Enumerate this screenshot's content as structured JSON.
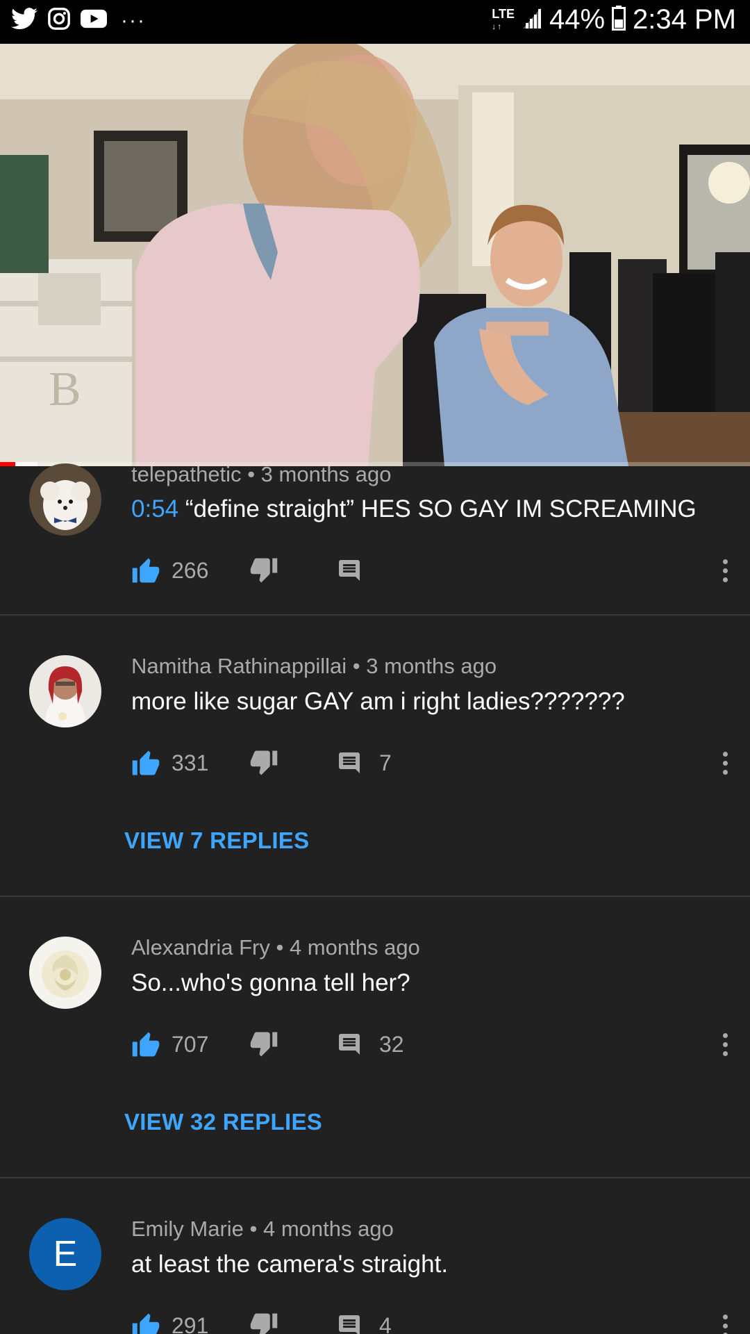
{
  "status_bar": {
    "network": "LTE",
    "battery": "44%",
    "time": "2:34 PM",
    "overflow": "···",
    "icons": [
      "twitter-icon",
      "instagram-icon",
      "youtube-icon"
    ]
  },
  "video": {
    "progress": 0.02,
    "buffered": 0.05,
    "accent": "#ff0000"
  },
  "comments": [
    {
      "author": "telepathetic",
      "time": "3 months ago",
      "timestamp_link": "0:54",
      "text": "“define straight” HES SO GAY IM SCREAMING",
      "likes": "266",
      "replies": "",
      "view_replies": ""
    },
    {
      "author": "Namitha Rathinappillai",
      "time": "3 months ago",
      "timestamp_link": "",
      "text": "more like sugar GAY am i right ladies???????",
      "likes": "331",
      "replies": "7",
      "view_replies": "VIEW 7 REPLIES"
    },
    {
      "author": "Alexandria Fry",
      "time": "4 months ago",
      "timestamp_link": "",
      "text": "So...who's gonna tell her?",
      "likes": "707",
      "replies": "32",
      "view_replies": "VIEW 32 REPLIES"
    },
    {
      "author": "Emily Marie",
      "avatar_letter": "E",
      "time": "4 months ago",
      "timestamp_link": "",
      "text": "at least the camera's straight.",
      "likes": "291",
      "replies": "4",
      "view_replies": ""
    }
  ],
  "colors": {
    "background": "#212121",
    "link": "#3ea6ff",
    "like_active": "#3ea6ff",
    "muted": "#aaaaaa"
  }
}
